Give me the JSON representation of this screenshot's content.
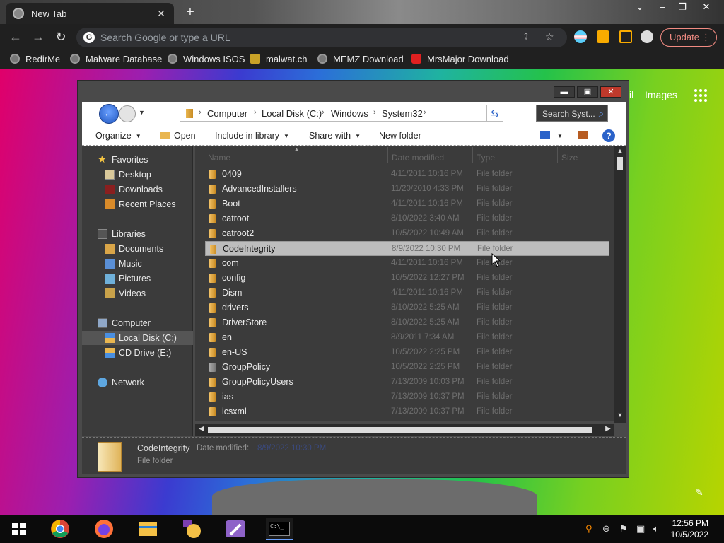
{
  "browser": {
    "tab_title": "New Tab",
    "tab_close": "✕",
    "new_tab": "+",
    "window_controls": [
      "⌄",
      "–",
      "❐",
      "✕"
    ],
    "omnibox_placeholder": "Search Google or type a URL",
    "update_label": "Update",
    "bookmarks": [
      "RedirMe",
      "Malware Database",
      "Windows ISOS",
      "malwat.ch",
      "MEMZ Download",
      "MrsMajor Download"
    ],
    "accent": "#f28b82"
  },
  "google_page": {
    "gmail_partial": "il",
    "images_link": "Images"
  },
  "explorer": {
    "window_buttons": [
      "▬",
      "▣",
      "✕"
    ],
    "breadcrumb": [
      "Computer",
      "Local Disk (C:)",
      "Windows",
      "System32"
    ],
    "search_placeholder": "Search Syst...",
    "commands": {
      "organize": "Organize",
      "open": "Open",
      "include": "Include in library",
      "share": "Share with",
      "new_folder": "New folder"
    },
    "nav": {
      "favorites": "Favorites",
      "desktop": "Desktop",
      "downloads": "Downloads",
      "recent": "Recent Places",
      "libraries": "Libraries",
      "documents": "Documents",
      "music": "Music",
      "pictures": "Pictures",
      "videos": "Videos",
      "computer": "Computer",
      "local_disk": "Local Disk (C:)",
      "cd_drive": "CD Drive (E:)",
      "network": "Network"
    },
    "columns": [
      "Name",
      "Date modified",
      "Type",
      "Size"
    ],
    "files": [
      {
        "name": "0409",
        "date": "4/11/2011 10:16 PM",
        "type": "File folder"
      },
      {
        "name": "AdvancedInstallers",
        "date": "11/20/2010 4:33 PM",
        "type": "File folder"
      },
      {
        "name": "Boot",
        "date": "4/11/2011 10:16 PM",
        "type": "File folder"
      },
      {
        "name": "catroot",
        "date": "8/10/2022 3:40 AM",
        "type": "File folder"
      },
      {
        "name": "catroot2",
        "date": "10/5/2022 10:49 AM",
        "type": "File folder"
      },
      {
        "name": "CodeIntegrity",
        "date": "8/9/2022 10:30 PM",
        "type": "File folder"
      },
      {
        "name": "com",
        "date": "4/11/2011 10:16 PM",
        "type": "File folder"
      },
      {
        "name": "config",
        "date": "10/5/2022 12:27 PM",
        "type": "File folder"
      },
      {
        "name": "Dism",
        "date": "4/11/2011 10:16 PM",
        "type": "File folder"
      },
      {
        "name": "drivers",
        "date": "8/10/2022 5:25 AM",
        "type": "File folder"
      },
      {
        "name": "DriverStore",
        "date": "8/10/2022 5:25 AM",
        "type": "File folder"
      },
      {
        "name": "en",
        "date": "8/9/2011 7:34 AM",
        "type": "File folder"
      },
      {
        "name": "en-US",
        "date": "10/5/2022 2:25 PM",
        "type": "File folder"
      },
      {
        "name": "GroupPolicy",
        "date": "10/5/2022 2:25 PM",
        "type": "File folder"
      },
      {
        "name": "GroupPolicyUsers",
        "date": "7/13/2009 10:03 PM",
        "type": "File folder"
      },
      {
        "name": "ias",
        "date": "7/13/2009 10:37 PM",
        "type": "File folder"
      },
      {
        "name": "icsxml",
        "date": "7/13/2009 10:37 PM",
        "type": "File folder"
      }
    ],
    "selected_index": 5,
    "details": {
      "name": "CodeIntegrity",
      "modified_label": "Date modified:",
      "modified_value": "8/9/2022 10:30 PM",
      "type": "File folder"
    }
  },
  "taskbar": {
    "time": "12:56 PM",
    "date": "10/5/2022",
    "cmd_icon_text": "C:\\_"
  }
}
